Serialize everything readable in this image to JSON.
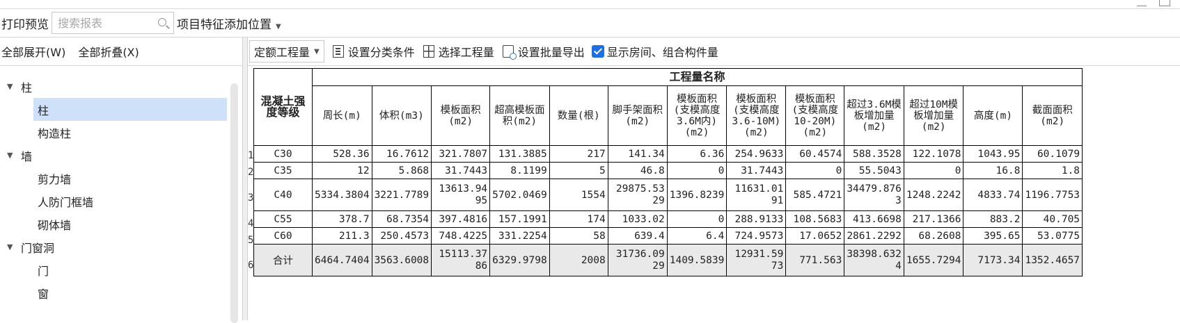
{
  "toolbar1": {
    "print_preview": "打印预览",
    "search_placeholder": "搜索报表",
    "feature_position": "项目特征添加位置"
  },
  "left": {
    "expand_all": "全部展开(W)",
    "collapse_all": "全部折叠(X)",
    "tree": [
      {
        "label": "柱",
        "level": 0
      },
      {
        "label": "柱",
        "level": 1,
        "selected": true
      },
      {
        "label": "构造柱",
        "level": 1
      },
      {
        "label": "墙",
        "level": 0
      },
      {
        "label": "剪力墙",
        "level": 1
      },
      {
        "label": "人防门框墙",
        "level": 1
      },
      {
        "label": "砌体墙",
        "level": 1
      },
      {
        "label": "门窗洞",
        "level": 0
      },
      {
        "label": "门",
        "level": 1
      },
      {
        "label": "窗",
        "level": 1
      }
    ]
  },
  "toolbar2": {
    "quota_combo": "定额工程量",
    "set_category": "设置分类条件",
    "select_quantity": "选择工程量",
    "batch_export": "设置批量导出",
    "show_room": "显示房间、组合构件量"
  },
  "table": {
    "group_header": "工程量名称",
    "grade_header": "混凝土强度等级",
    "columns": [
      "周长(m)",
      "体积(m3)",
      "模板面积(m2)",
      "超高模板面积(m2)",
      "数量(根)",
      "脚手架面积(m2)",
      "模板面积(支模高度3.6M内)(m2)",
      "模板面积(支模高度3.6-10M)(m2)",
      "模板面积(支模高度10-20M)(m2)",
      "超过3.6M模板增加量(m2)",
      "超过10M模板增加量(m2)",
      "高度(m)",
      "截面面积(m2)"
    ],
    "rows": [
      {
        "num": "1",
        "grade": "C30",
        "cells": [
          "528.36",
          "16.7612",
          "321.7807",
          "131.3885",
          "217",
          "141.34",
          "6.36",
          "254.9633",
          "60.4574",
          "588.3528",
          "122.1078",
          "1043.95",
          "60.1079"
        ]
      },
      {
        "num": "2",
        "grade": "C35",
        "cells": [
          "12",
          "5.868",
          "31.7443",
          "8.1199",
          "5",
          "46.8",
          "0",
          "31.7443",
          "0",
          "55.5043",
          "0",
          "16.8",
          "1.8"
        ]
      },
      {
        "num": "3",
        "grade": "C40",
        "cells": [
          "5334.3804",
          "3221.7789",
          "13613.9495",
          "5702.0469",
          "1554",
          "29875.5329",
          "1396.8239",
          "11631.0191",
          "585.4721",
          "34479.8763",
          "1248.2242",
          "4833.74",
          "1196.7753"
        ]
      },
      {
        "num": "4",
        "grade": "C55",
        "cells": [
          "378.7",
          "68.7354",
          "397.4816",
          "157.1991",
          "174",
          "1033.02",
          "0",
          "288.9133",
          "108.5683",
          "413.6698",
          "217.1366",
          "883.2",
          "40.705"
        ]
      },
      {
        "num": "5",
        "grade": "C60",
        "cells": [
          "211.3",
          "250.4573",
          "748.4225",
          "331.2254",
          "58",
          "639.4",
          "6.4",
          "724.9573",
          "17.0652",
          "2861.2292",
          "68.2608",
          "395.65",
          "53.0775"
        ]
      },
      {
        "num": "6",
        "grade": "合计",
        "cells": [
          "6464.7404",
          "3563.6008",
          "15113.3786",
          "6329.9798",
          "2008",
          "31736.0929",
          "1409.5839",
          "12931.5973",
          "771.563",
          "38398.6324",
          "1655.7294",
          "7173.34",
          "1352.4657"
        ]
      }
    ]
  }
}
